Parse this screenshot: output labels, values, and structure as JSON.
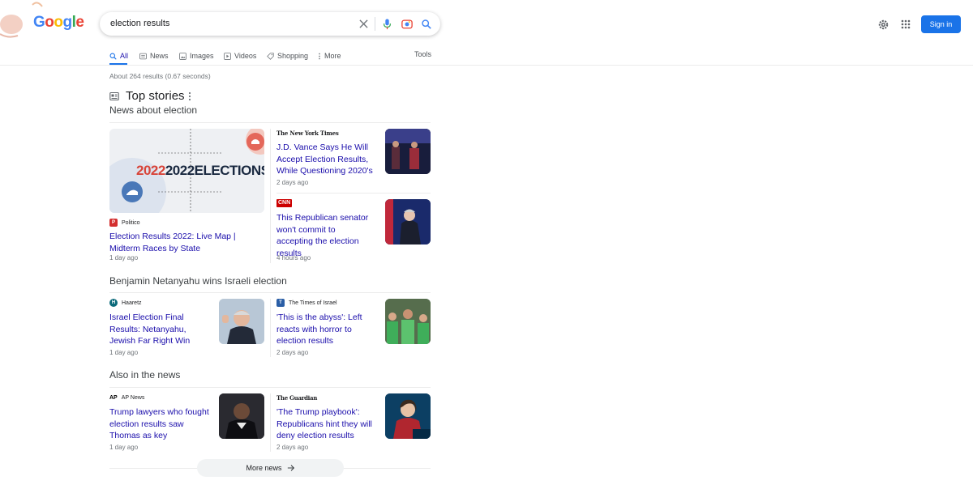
{
  "logo": {
    "text": "Google"
  },
  "search": {
    "value": "election results",
    "placeholder": ""
  },
  "header": {
    "signin_label": "Sign in"
  },
  "tabs": [
    {
      "label": "All",
      "icon": "search-icon",
      "active": true
    },
    {
      "label": "News",
      "icon": "news-icon",
      "active": false
    },
    {
      "label": "Images",
      "icon": "image-icon",
      "active": false
    },
    {
      "label": "Videos",
      "icon": "video-icon",
      "active": false
    },
    {
      "label": "Shopping",
      "icon": "tag-icon",
      "active": false
    },
    {
      "label": "More",
      "icon": "more-vert-icon",
      "active": false
    }
  ],
  "tools_label": "Tools",
  "result_stats": "About 264 results (0.67 seconds)",
  "top_stories": {
    "title": "Top stories",
    "sections": [
      {
        "title": "News about election",
        "featured": {
          "thumb_text": "2022ELECTIONS",
          "source": "Politico",
          "headline": "Election Results 2022: Live Map | Midterm Races by State",
          "time": "1 day ago"
        },
        "articles": [
          {
            "source": "The New York Times",
            "headline": "J.D. Vance Says He Will Accept Election Results, While Questioning 2020's",
            "time": "2 days ago"
          },
          {
            "source": "CNN",
            "headline": "This Republican senator won't commit to accepting the election results",
            "time": "4 hours ago"
          }
        ]
      },
      {
        "title": "Benjamin Netanyahu wins Israeli election",
        "articles": [
          {
            "source": "Haaretz",
            "headline": "Israel Election Final Results: Netanyahu, Jewish Far Right Win Power, Fiasco for Left ...",
            "time": "1 day ago"
          },
          {
            "source": "The Times of Israel",
            "headline": "'This is the abyss': Left reacts with horror to election results",
            "time": "2 days ago"
          }
        ]
      },
      {
        "title": "Also in the news",
        "articles": [
          {
            "source": "AP News",
            "headline": "Trump lawyers who fought election results saw Thomas as key",
            "time": "1 day ago"
          },
          {
            "source": "The Guardian",
            "headline": "'The Trump playbook': Republicans hint they will deny election results",
            "time": "2 days ago"
          }
        ]
      }
    ],
    "more_news_label": "More news"
  },
  "colors": {
    "link": "#1a0dab",
    "accent": "#1a73e8",
    "politico": "#d32f2f",
    "cnn": "#cc0000"
  }
}
